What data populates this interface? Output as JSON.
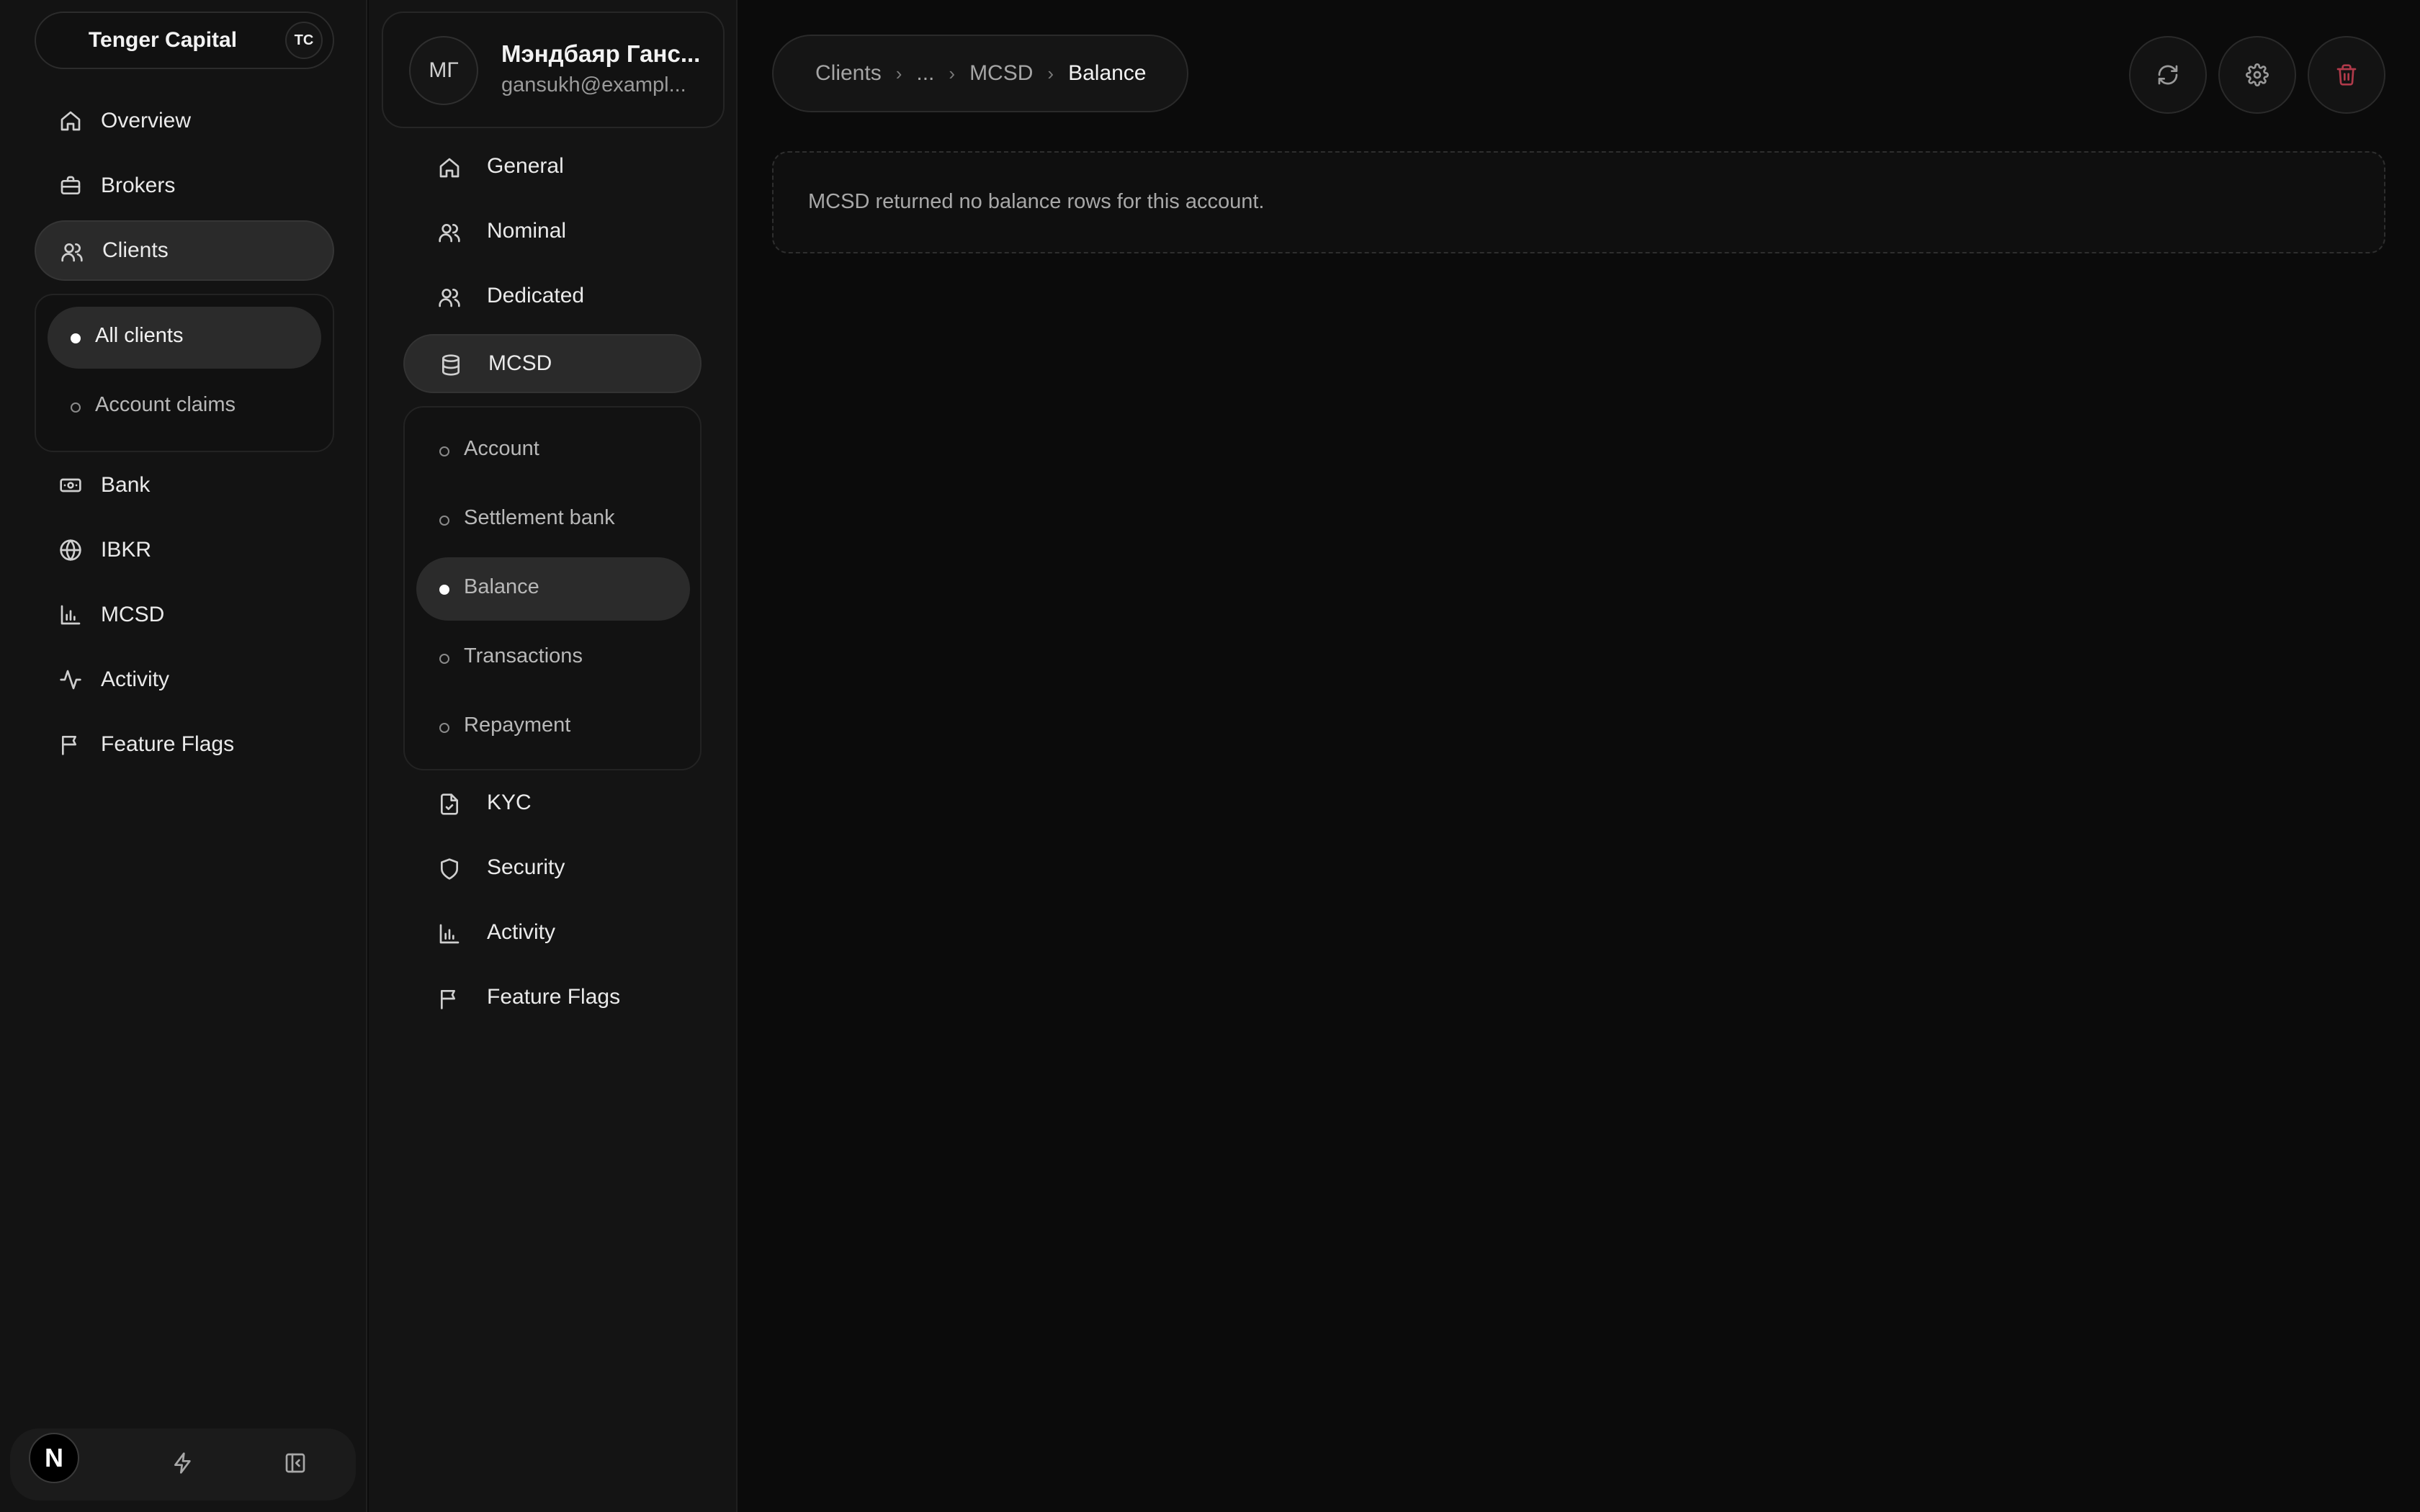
{
  "sidebar": {
    "org_name": "Tenger Capital",
    "org_badge": "TC",
    "items": [
      {
        "label": "Overview",
        "icon": "home-icon"
      },
      {
        "label": "Brokers",
        "icon": "briefcase-icon"
      },
      {
        "label": "Clients",
        "icon": "users-icon"
      },
      {
        "label": "Bank",
        "icon": "banknote-icon"
      },
      {
        "label": "IBKR",
        "icon": "globe-icon"
      },
      {
        "label": "MCSD",
        "icon": "bar-chart-icon"
      },
      {
        "label": "Activity",
        "icon": "activity-icon"
      },
      {
        "label": "Feature Flags",
        "icon": "flag-icon"
      }
    ],
    "active": "Clients",
    "clients_sub": [
      {
        "label": "All clients"
      },
      {
        "label": "Account claims"
      }
    ],
    "bottom": {
      "logo": "N",
      "icons": [
        "bolt-icon",
        "collapse-sidebar-icon"
      ]
    }
  },
  "client": {
    "initials": "МГ",
    "name": "Мэндбаяр Ганс...",
    "email": "gansukh@exampl..."
  },
  "client_nav": {
    "items_top": [
      {
        "label": "General",
        "icon": "home-icon"
      },
      {
        "label": "Nominal",
        "icon": "users-icon"
      },
      {
        "label": "Dedicated",
        "icon": "users-icon"
      },
      {
        "label": "MCSD",
        "icon": "database-icon"
      }
    ],
    "mcsd_sub": [
      {
        "label": "Account"
      },
      {
        "label": "Settlement bank"
      },
      {
        "label": "Balance"
      },
      {
        "label": "Transactions"
      },
      {
        "label": "Repayment"
      }
    ],
    "active_sub": "Balance",
    "items_bottom": [
      {
        "label": "KYC",
        "icon": "file-check-icon"
      },
      {
        "label": "Security",
        "icon": "shield-icon"
      },
      {
        "label": "Activity",
        "icon": "bar-chart-icon"
      },
      {
        "label": "Feature Flags",
        "icon": "flag-icon"
      }
    ]
  },
  "breadcrumb": {
    "items": [
      "Clients",
      "...",
      "MCSD",
      "Balance"
    ]
  },
  "actions": [
    {
      "icon": "refresh-icon"
    },
    {
      "icon": "gear-icon"
    },
    {
      "icon": "trash-icon",
      "color": "#b03a4a"
    }
  ],
  "empty_state": {
    "message": "MCSD returned no balance rows for this account."
  }
}
